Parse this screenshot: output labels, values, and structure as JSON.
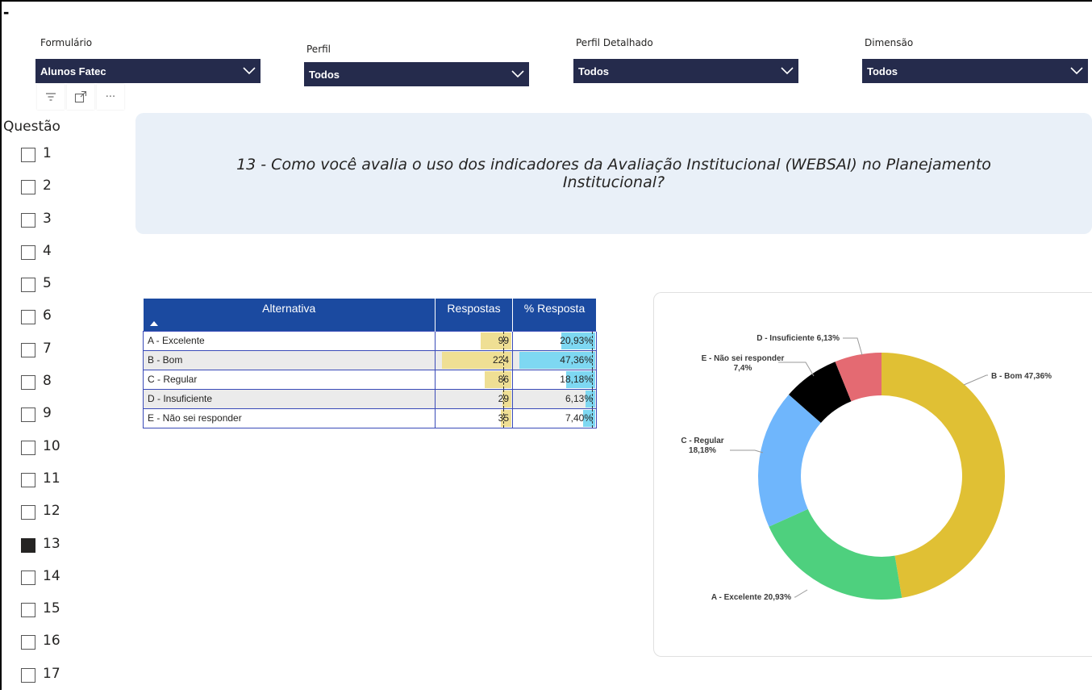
{
  "corner_mark": "-",
  "filters": {
    "formulario": {
      "label": "Formulário",
      "value": "Alunos Fatec"
    },
    "perfil": {
      "label": "Perfil",
      "value": "Todos"
    },
    "perfil_detalhado": {
      "label": "Perfil Detalhado",
      "value": "Todos"
    },
    "dimensao": {
      "label": "Dimensão",
      "value": "Todos"
    }
  },
  "toolbar": {
    "icons": [
      "filter-icon",
      "focus-mode-icon",
      "more-options-icon"
    ],
    "more_glyph": "···"
  },
  "questao": {
    "title": "Questão",
    "items": [
      {
        "label": "1",
        "checked": false
      },
      {
        "label": "2",
        "checked": false
      },
      {
        "label": "3",
        "checked": false
      },
      {
        "label": "4",
        "checked": false
      },
      {
        "label": "5",
        "checked": false
      },
      {
        "label": "6",
        "checked": false
      },
      {
        "label": "7",
        "checked": false
      },
      {
        "label": "8",
        "checked": false
      },
      {
        "label": "9",
        "checked": false
      },
      {
        "label": "10",
        "checked": false
      },
      {
        "label": "11",
        "checked": false
      },
      {
        "label": "12",
        "checked": false
      },
      {
        "label": "13",
        "checked": true
      },
      {
        "label": "14",
        "checked": false
      },
      {
        "label": "15",
        "checked": false
      },
      {
        "label": "16",
        "checked": false
      },
      {
        "label": "17",
        "checked": false
      }
    ]
  },
  "question_text": "13 - Como você avalia o uso dos indicadores da Avaliação Institucional (WEBSAI) no Planejamento Institucional?",
  "table": {
    "headers": {
      "alternativa": "Alternativa",
      "respostas": "Respostas",
      "pct": "% Resposta"
    },
    "rows": [
      {
        "alternativa": "A - Excelente",
        "respostas": "99",
        "pct": "20,93%"
      },
      {
        "alternativa": "B - Bom",
        "respostas": "224",
        "pct": "47,36%"
      },
      {
        "alternativa": "C - Regular",
        "respostas": "86",
        "pct": "18,18%"
      },
      {
        "alternativa": "D - Insuficiente",
        "respostas": "29",
        "pct": "6,13%"
      },
      {
        "alternativa": "E - Não sei responder",
        "respostas": "35",
        "pct": "7,40%"
      }
    ],
    "bar_colors": {
      "respostas": "#efdf94",
      "pct": "#7ed8f2"
    }
  },
  "chart_data": {
    "type": "pie",
    "donut": true,
    "slices": [
      {
        "name": "B - Bom",
        "value": 47.36,
        "color": "#e0c034",
        "label": "B - Bom 47,36%"
      },
      {
        "name": "A - Excelente",
        "value": 20.93,
        "color": "#4ed07e",
        "label": "A - Excelente 20,93%"
      },
      {
        "name": "C - Regular",
        "value": 18.18,
        "color": "#6fb6fc",
        "label": [
          "C - Regular",
          "18,18%"
        ]
      },
      {
        "name": "E - Não sei responder",
        "value": 7.4,
        "color": "#000000",
        "label": [
          "E - Não sei responder",
          "7,4%"
        ]
      },
      {
        "name": "D - Insuficiente",
        "value": 6.13,
        "color": "#e46a72",
        "label": "D - Insuficiente 6,13%"
      }
    ]
  }
}
